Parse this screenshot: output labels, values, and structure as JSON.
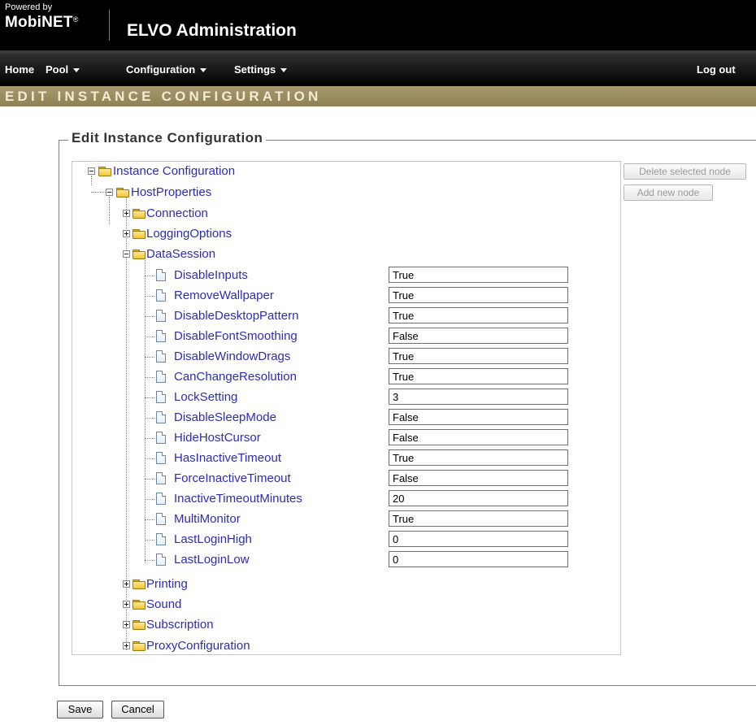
{
  "header": {
    "powered_by": "Powered by",
    "brand": "MobiNET",
    "brand_mark": "®",
    "app_title": "ELVO Administration"
  },
  "nav": {
    "home": "Home",
    "pool": "Pool",
    "configuration": "Configuration",
    "settings": "Settings",
    "logout": "Log out"
  },
  "banner": {
    "title": "EDIT INSTANCE CONFIGURATION"
  },
  "form": {
    "legend": "Edit Instance Configuration",
    "delete_node": "Delete selected node",
    "add_node": "Add new node",
    "save": "Save",
    "cancel": "Cancel"
  },
  "tree": {
    "root": "Instance Configuration",
    "host": "HostProperties",
    "collapsed_before": [
      "Connection",
      "LoggingOptions"
    ],
    "data_session": "DataSession",
    "properties": [
      {
        "name": "DisableInputs",
        "value": "True"
      },
      {
        "name": "RemoveWallpaper",
        "value": "True"
      },
      {
        "name": "DisableDesktopPattern",
        "value": "True"
      },
      {
        "name": "DisableFontSmoothing",
        "value": "False"
      },
      {
        "name": "DisableWindowDrags",
        "value": "True"
      },
      {
        "name": "CanChangeResolution",
        "value": "True"
      },
      {
        "name": "LockSetting",
        "value": "3"
      },
      {
        "name": "DisableSleepMode",
        "value": "False"
      },
      {
        "name": "HideHostCursor",
        "value": "False"
      },
      {
        "name": "HasInactiveTimeout",
        "value": "True"
      },
      {
        "name": "ForceInactiveTimeout",
        "value": "False"
      },
      {
        "name": "InactiveTimeoutMinutes",
        "value": "20"
      },
      {
        "name": "MultiMonitor",
        "value": "True"
      },
      {
        "name": "LastLoginHigh",
        "value": "0"
      },
      {
        "name": "LastLoginLow",
        "value": "0"
      }
    ],
    "collapsed_after": [
      "Printing",
      "Sound",
      "Subscription",
      "ProxyConfiguration"
    ]
  }
}
